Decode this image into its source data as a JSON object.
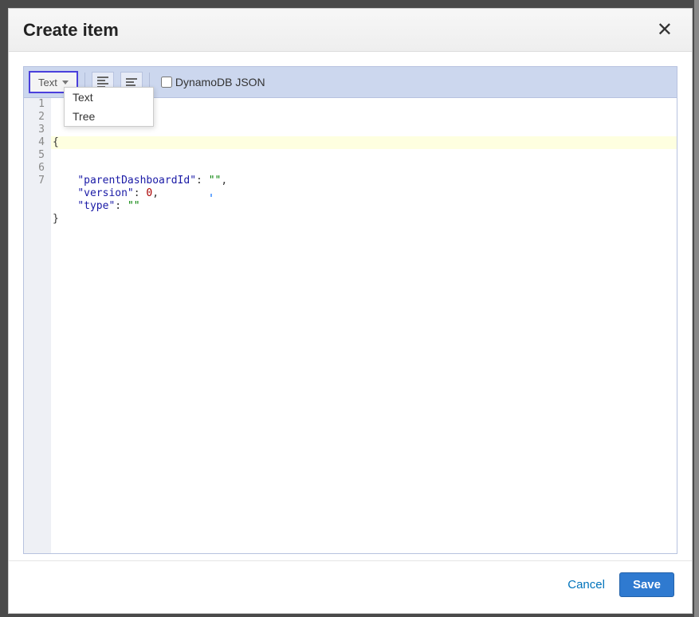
{
  "modal": {
    "title": "Create item"
  },
  "toolbar": {
    "view_label": "Text",
    "checkbox_label": "DynamoDB JSON",
    "checkbox_checked": false
  },
  "dropdown": {
    "options": [
      "Text",
      "Tree"
    ]
  },
  "editor": {
    "lines": [
      {
        "n": "1",
        "raw": "{",
        "tokens": [
          {
            "t": "{",
            "c": ""
          }
        ]
      },
      {
        "n": "2",
        "raw": "",
        "tokens": []
      },
      {
        "n": "3",
        "raw": "",
        "tokens": []
      },
      {
        "n": "4",
        "raw": "    \"parentDashboardId\": \"\",",
        "tokens": [
          {
            "t": "    ",
            "c": ""
          },
          {
            "t": "\"parentDashboardId\"",
            "c": "s-key"
          },
          {
            "t": ": ",
            "c": ""
          },
          {
            "t": "\"\"",
            "c": "s-str"
          },
          {
            "t": ",",
            "c": ""
          }
        ]
      },
      {
        "n": "5",
        "raw": "    \"version\": 0,",
        "tokens": [
          {
            "t": "    ",
            "c": ""
          },
          {
            "t": "\"version\"",
            "c": "s-key"
          },
          {
            "t": ": ",
            "c": ""
          },
          {
            "t": "0",
            "c": "s-num"
          },
          {
            "t": ",",
            "c": ""
          }
        ]
      },
      {
        "n": "6",
        "raw": "    \"type\": \"\"",
        "tokens": [
          {
            "t": "    ",
            "c": ""
          },
          {
            "t": "\"type\"",
            "c": "s-key"
          },
          {
            "t": ": ",
            "c": ""
          },
          {
            "t": "\"\"",
            "c": "s-str"
          }
        ]
      },
      {
        "n": "7",
        "raw": "}",
        "tokens": [
          {
            "t": "}",
            "c": ""
          }
        ]
      }
    ],
    "highlighted_line": 1
  },
  "footer": {
    "cancel_label": "Cancel",
    "save_label": "Save"
  }
}
